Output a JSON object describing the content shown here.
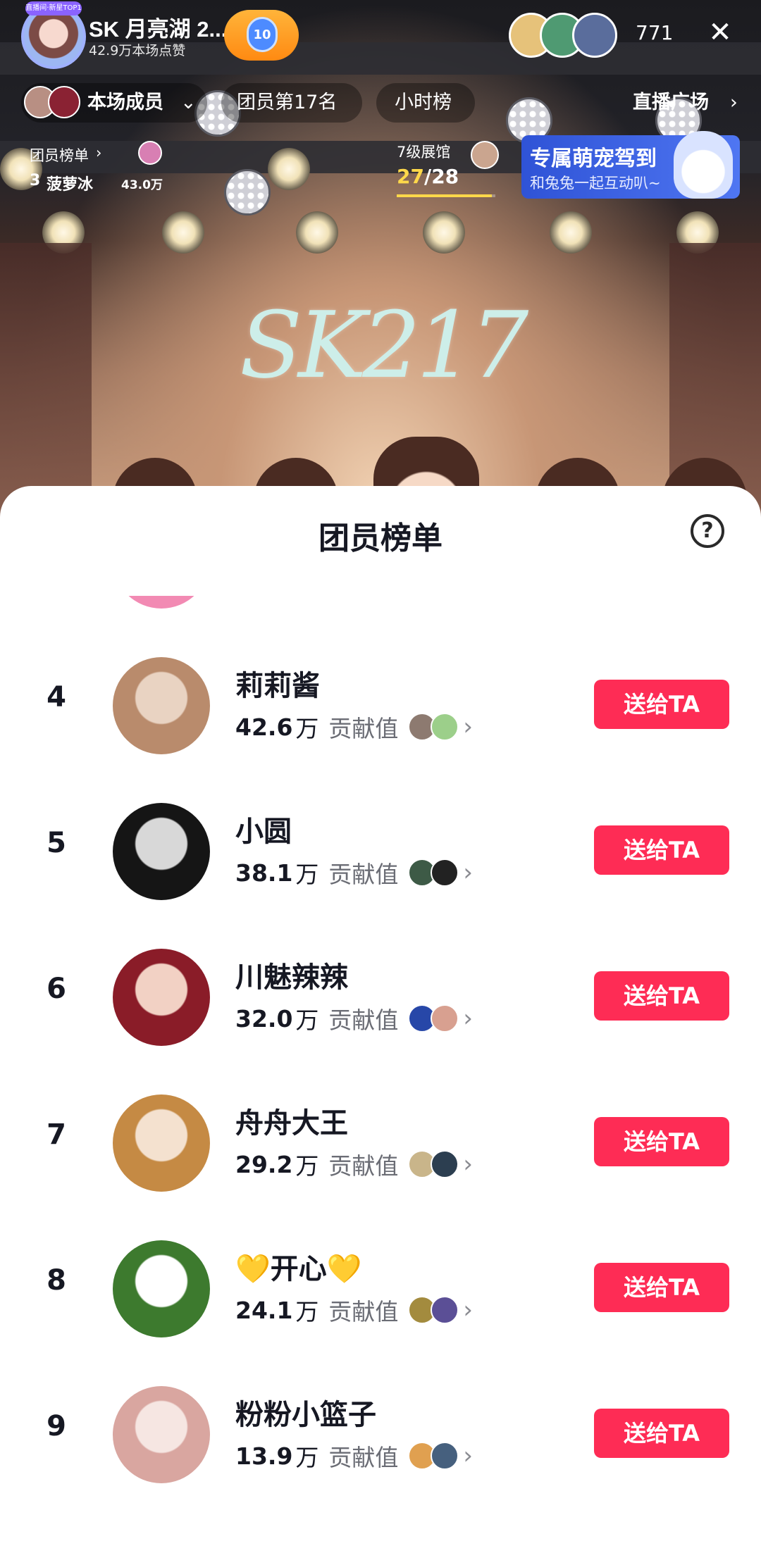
{
  "header": {
    "host_badge": "直播间·新星TOP1",
    "host_name": "SK 月亮湖 2...",
    "host_likes": "42.9万本场点赞",
    "level": "10",
    "viewer_count": "771",
    "close_icon": "close-icon"
  },
  "sub_header": {
    "members_label": "本场成员",
    "group_rank": "团员第17名",
    "hour_rank": "小时榜",
    "live_plaza": "直播广场"
  },
  "fan_board": {
    "label": "团员榜单",
    "rank": "3",
    "name": "菠萝冰",
    "value": "43.0万"
  },
  "museum": {
    "label": "7级展馆",
    "current": "27",
    "total": "/28",
    "progress": 0.964
  },
  "promo": {
    "title": "专属萌宠驾到",
    "subtitle": "和兔兔一起互动叭~"
  },
  "stage": {
    "logo_text": "SK217"
  },
  "sheet": {
    "title": "团员榜单",
    "help_icon": "help-circle-icon",
    "contribution_label": "贡献值",
    "gift_label": "送给TA",
    "chevron": "›",
    "rows": [
      {
        "rank": "3",
        "name": "菠萝冰",
        "value": "43.0",
        "unit": "万",
        "avatar_colors": [
          "#f28ab3",
          "#ffd6e6"
        ],
        "fan_colors": [
          "#efe3c8",
          "#f6c64b"
        ]
      },
      {
        "rank": "4",
        "name": "莉莉酱",
        "value": "42.6",
        "unit": "万",
        "avatar_colors": [
          "#b98b6c",
          "#e9d3c2"
        ],
        "fan_colors": [
          "#8d7a70",
          "#9ccf8a"
        ]
      },
      {
        "rank": "5",
        "name": "小圆",
        "value": "38.1",
        "unit": "万",
        "avatar_colors": [
          "#151515",
          "#d8d8d8"
        ],
        "fan_colors": [
          "#3d5a46",
          "#222222"
        ]
      },
      {
        "rank": "6",
        "name": "川魅辣辣",
        "value": "32.0",
        "unit": "万",
        "avatar_colors": [
          "#8a1c28",
          "#f2d1c4"
        ],
        "fan_colors": [
          "#2747a8",
          "#d8a090"
        ]
      },
      {
        "rank": "7",
        "name": "舟舟大王",
        "value": "29.2",
        "unit": "万",
        "avatar_colors": [
          "#c58a44",
          "#f4e1cf"
        ],
        "fan_colors": [
          "#c9b58a",
          "#2c3e50"
        ]
      },
      {
        "rank": "8",
        "name": "💛开心💛",
        "value": "24.1",
        "unit": "万",
        "avatar_colors": [
          "#3d7a2e",
          "#ffffff"
        ],
        "fan_colors": [
          "#a38b3e",
          "#5b4f96"
        ]
      },
      {
        "rank": "9",
        "name": "粉粉小篮子",
        "value": "13.9",
        "unit": "万",
        "avatar_colors": [
          "#d9a6a0",
          "#f6e6e2"
        ],
        "fan_colors": [
          "#e0a050",
          "#46607e"
        ]
      }
    ]
  }
}
